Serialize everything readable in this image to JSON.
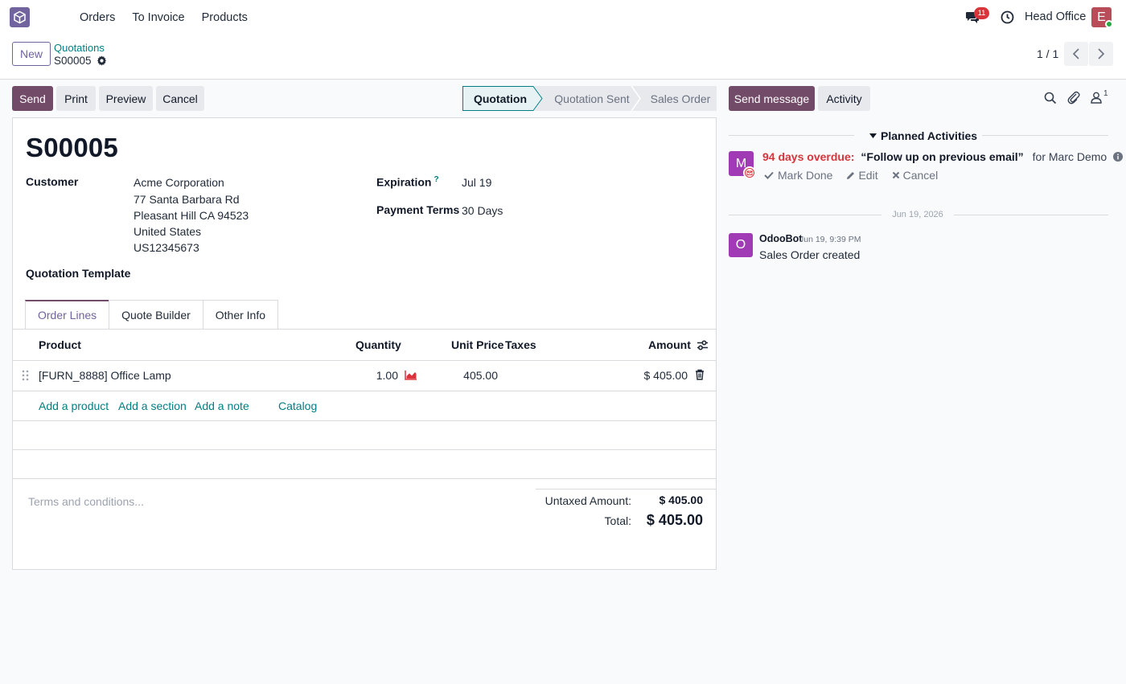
{
  "nav": {
    "items": [
      "Orders",
      "To Invoice",
      "Products"
    ]
  },
  "systray": {
    "message_count": "11",
    "company": "Head Office",
    "user_initial": "E"
  },
  "control_panel": {
    "new_label": "New",
    "breadcrumb": "Quotations",
    "record_name": "S00005",
    "pager": "1 / 1"
  },
  "actions": {
    "send": "Send",
    "print": "Print",
    "preview": "Preview",
    "cancel": "Cancel"
  },
  "status": {
    "steps": [
      "Quotation",
      "Quotation Sent",
      "Sales Order"
    ],
    "current": "Quotation"
  },
  "form": {
    "title": "S00005",
    "customer_label": "Customer",
    "customer_lines": [
      "Acme Corporation",
      "77 Santa Barbara Rd",
      "Pleasant Hill CA 94523",
      "United States",
      "US12345673"
    ],
    "expiration_label": "Expiration",
    "expiration_help": "?",
    "expiration_value": "Jul 19",
    "payment_terms_label": "Payment Terms",
    "payment_terms_value": "30 Days",
    "template_label": "Quotation Template",
    "tabs": [
      "Order Lines",
      "Quote Builder",
      "Other Info"
    ],
    "columns": {
      "product": "Product",
      "quantity": "Quantity",
      "unit_price": "Unit Price",
      "taxes": "Taxes",
      "amount": "Amount"
    },
    "lines": [
      {
        "product": "[FURN_8888] Office Lamp",
        "quantity": "1.00",
        "unit_price": "405.00",
        "taxes": "",
        "amount": "$ 405.00"
      }
    ],
    "add_links": {
      "product": "Add a product",
      "section": "Add a section",
      "note": "Add a note",
      "catalog": "Catalog"
    },
    "terms_placeholder": "Terms and conditions...",
    "untaxed_label": "Untaxed Amount:",
    "untaxed_value": "$ 405.00",
    "total_label": "Total:",
    "total_value": "$ 405.00"
  },
  "chatter": {
    "send_message": "Send message",
    "activity": "Activity",
    "followers_count": "1",
    "planned_title": "Planned Activities",
    "activity_item": {
      "avatar": "M",
      "overdue": "94 days overdue:",
      "summary": "“Follow up on previous email”",
      "assignee": "for Marc Demo",
      "mark_done": "Mark Done",
      "edit": "Edit",
      "cancel": "Cancel"
    },
    "date_separator": "Jun 19, 2026",
    "messages": [
      {
        "avatar": "O",
        "author": "OdooBot",
        "time": "Jun 19, 9:39 PM",
        "body": "Sales Order created"
      }
    ]
  },
  "colors": {
    "brand": "#714b67",
    "link": "#017e84",
    "overdue": "#d9343b"
  }
}
